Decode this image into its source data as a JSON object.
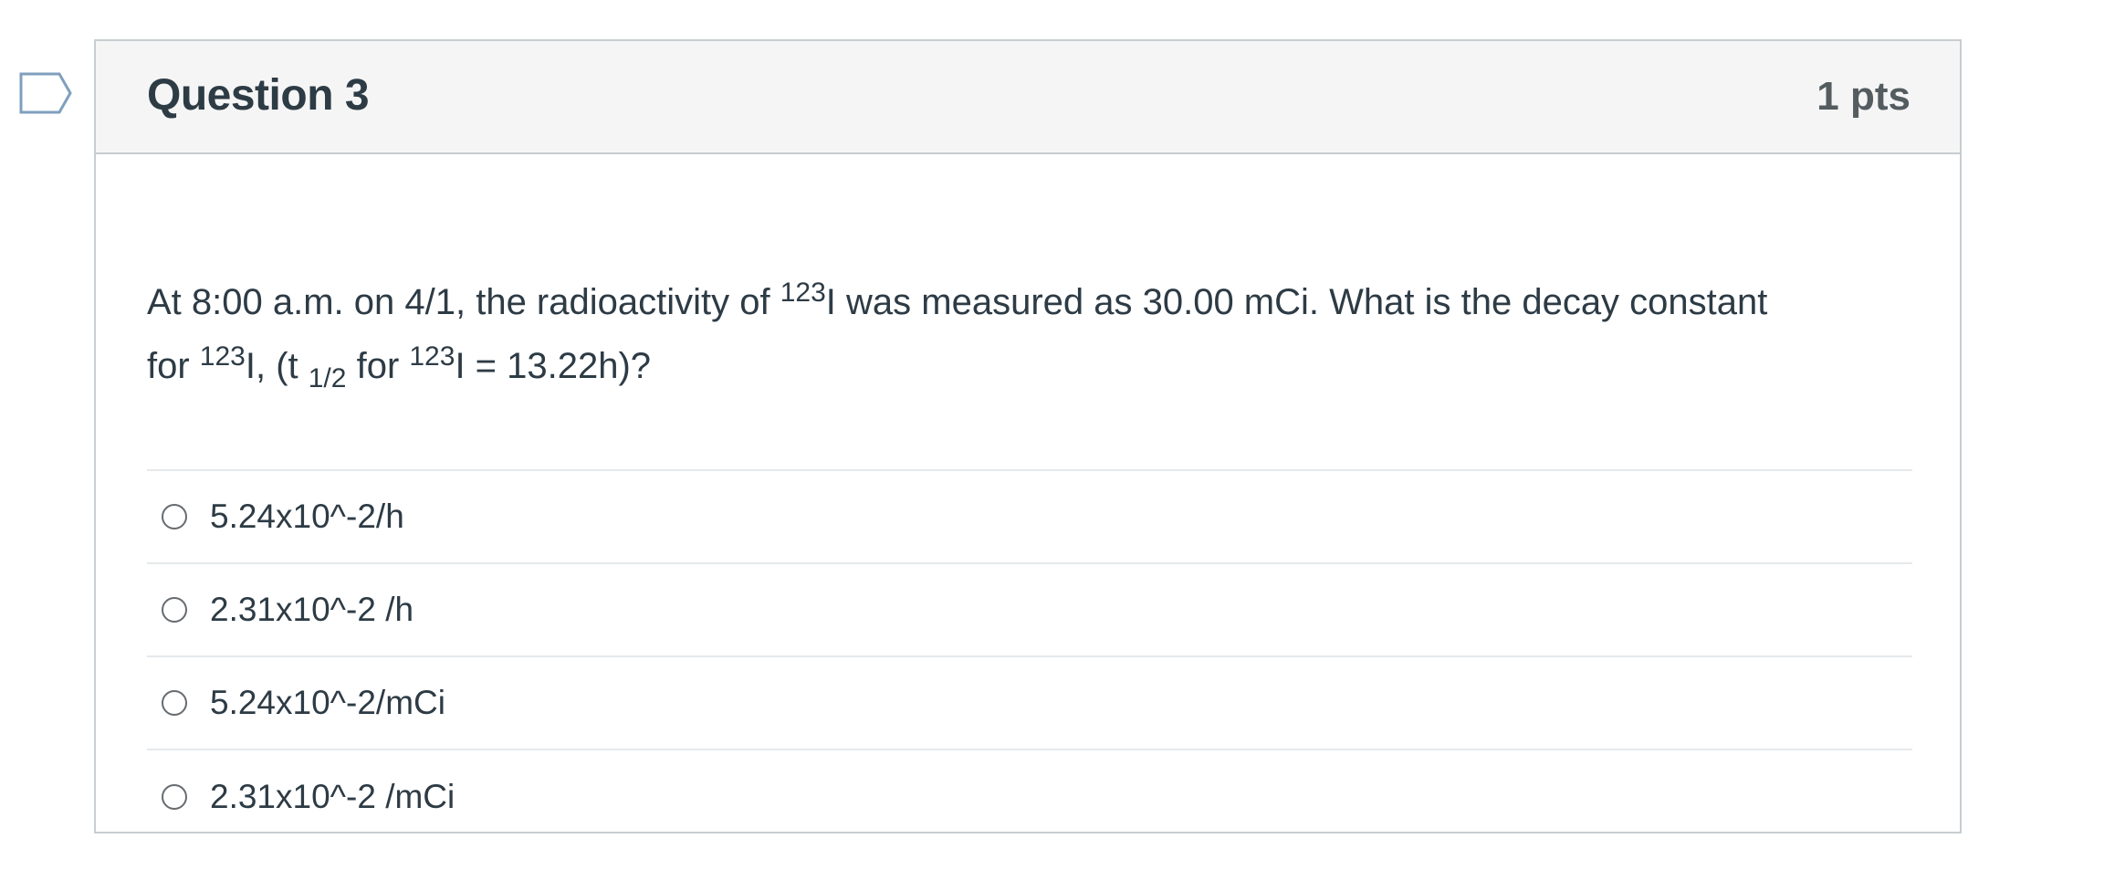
{
  "question": {
    "title": "Question 3",
    "points": "1 pts",
    "text": {
      "line1_part1": "At 8:00 a.m. on 4/1, the radioactivity of ",
      "line1_sup1": "123",
      "line1_part2": "I was measured as 30.00 mCi. What is the decay constant",
      "line2_part1": "for ",
      "line2_sup1": "123",
      "line2_part2": "I, (t ",
      "line2_sub1": "1/2",
      "line2_part3": " for ",
      "line2_sup2": "123",
      "line2_part4": "I = 13.22h)?"
    },
    "answers": [
      {
        "label": "5.24x10^-2/h"
      },
      {
        "label": "2.31x10^-2 /h"
      },
      {
        "label": "5.24x10^-2/mCi"
      },
      {
        "label": "2.31x10^-2 /mCi"
      }
    ]
  },
  "icons": {
    "flag": "flag-question-icon",
    "radio": "radio-button-icon"
  },
  "colors": {
    "text": "#2d3b45",
    "header_background": "#f5f5f5",
    "border": "#c7cdd1",
    "flag_outline": "#7f9fbd",
    "points_text": "#545c60"
  }
}
